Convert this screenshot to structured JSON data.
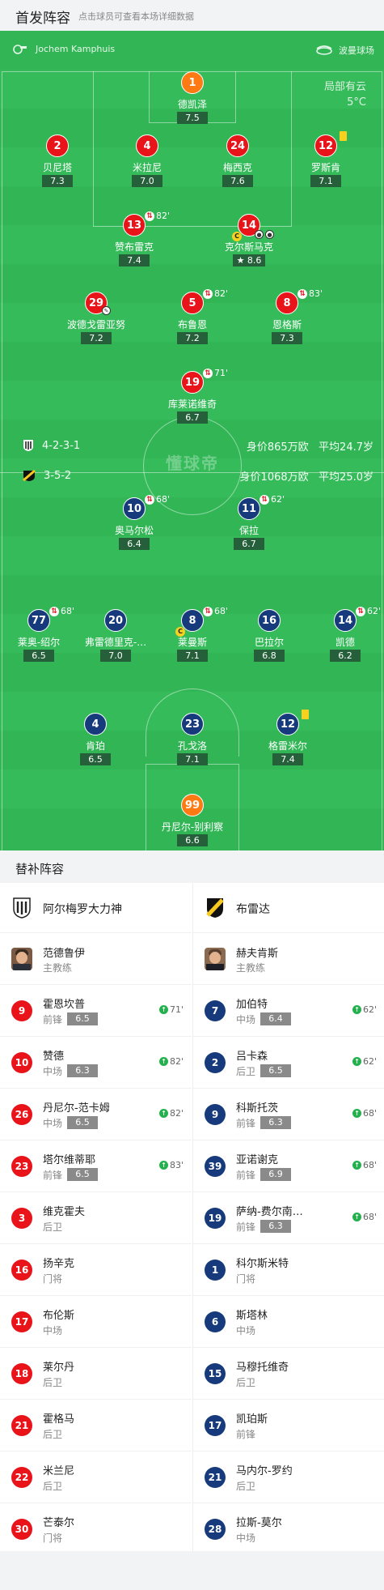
{
  "header": {
    "title": "首发阵容",
    "tip": "点击球员可查看本场详细数据"
  },
  "match": {
    "referee": "Jochem Kamphuis",
    "venue": "波曼球场",
    "weather": "局部有云",
    "temperature": "5°C"
  },
  "colors": {
    "pitch": "#31b555",
    "home": "#e8141a",
    "away": "#163a7c",
    "gk": "#ff7a12",
    "yellow_card": "#f7d11e"
  },
  "watermark": "懂球帝",
  "home_team": {
    "formation": "4-2-3-1",
    "value": "身价865万欧",
    "age": "平均24.7岁",
    "players": [
      {
        "num": "1",
        "name": "德凯泽",
        "rating": "7.5",
        "role": "gk"
      },
      {
        "num": "2",
        "name": "贝尼塔",
        "rating": "7.3"
      },
      {
        "num": "4",
        "name": "米拉尼",
        "rating": "7.0"
      },
      {
        "num": "24",
        "name": "梅西克",
        "rating": "7.6"
      },
      {
        "num": "12",
        "name": "罗斯肯",
        "rating": "7.1",
        "card": "yellow"
      },
      {
        "num": "13",
        "name": "赞布雷克",
        "rating": "7.4",
        "sub_min": "82'"
      },
      {
        "num": "14",
        "name": "克尔斯马克",
        "rating": "8.6",
        "captain": true,
        "goals": 2,
        "motm": true
      },
      {
        "num": "29",
        "name": "波德戈雷亚努",
        "rating": "7.2",
        "assist": true
      },
      {
        "num": "5",
        "name": "布鲁恩",
        "rating": "7.2",
        "sub_min": "82'"
      },
      {
        "num": "8",
        "name": "恩格斯",
        "rating": "7.3",
        "sub_min": "83'"
      },
      {
        "num": "19",
        "name": "库莱诺维奇",
        "rating": "6.7",
        "sub_min": "71'"
      }
    ]
  },
  "away_team": {
    "formation": "3-5-2",
    "value": "身价1068万欧",
    "age": "平均25.0岁",
    "players": [
      {
        "num": "10",
        "name": "奥马尔松",
        "rating": "6.4",
        "sub_min": "68'"
      },
      {
        "num": "11",
        "name": "保拉",
        "rating": "6.7",
        "sub_min": "62'"
      },
      {
        "num": "77",
        "name": "莱奥-绍尔",
        "rating": "6.5",
        "sub_min": "68'"
      },
      {
        "num": "20",
        "name": "弗雷德里克-…",
        "rating": "7.0"
      },
      {
        "num": "8",
        "name": "莱曼斯",
        "rating": "7.1",
        "sub_min": "68'",
        "captain": true
      },
      {
        "num": "16",
        "name": "巴拉尔",
        "rating": "6.8"
      },
      {
        "num": "14",
        "name": "凯德",
        "rating": "6.2",
        "sub_min": "62'"
      },
      {
        "num": "4",
        "name": "肯珀",
        "rating": "6.5"
      },
      {
        "num": "23",
        "name": "孔戈洛",
        "rating": "7.1"
      },
      {
        "num": "12",
        "name": "格雷米尔",
        "rating": "7.4",
        "card": "yellow"
      },
      {
        "num": "99",
        "name": "丹尼尔-别利察",
        "rating": "6.6",
        "role": "gk"
      }
    ]
  },
  "subs_title": "替补阵容",
  "home_subs": {
    "team": "阿尔梅罗大力神",
    "coach_name": "范德鲁伊",
    "coach_role": "主教练",
    "list": [
      {
        "num": "9",
        "name": "霍恩坎普",
        "pos": "前锋",
        "rating": "6.5",
        "min": "71'"
      },
      {
        "num": "10",
        "name": "赞德",
        "pos": "中场",
        "rating": "6.3",
        "min": "82'"
      },
      {
        "num": "26",
        "name": "丹尼尔-范卡姆",
        "pos": "中场",
        "rating": "6.5",
        "min": "82'"
      },
      {
        "num": "23",
        "name": "塔尔维蒂耶",
        "pos": "前锋",
        "rating": "6.5",
        "min": "83'"
      },
      {
        "num": "3",
        "name": "维克霍夫",
        "pos": "后卫"
      },
      {
        "num": "16",
        "name": "扬辛克",
        "pos": "门将"
      },
      {
        "num": "17",
        "name": "布伦斯",
        "pos": "中场"
      },
      {
        "num": "18",
        "name": "莱尔丹",
        "pos": "后卫"
      },
      {
        "num": "21",
        "name": "霍格马",
        "pos": "后卫"
      },
      {
        "num": "22",
        "name": "米兰尼",
        "pos": "后卫"
      },
      {
        "num": "30",
        "name": "芒泰尔",
        "pos": "门将"
      }
    ]
  },
  "away_subs": {
    "team": "布雷达",
    "coach_name": "赫夫肯斯",
    "coach_role": "主教练",
    "list": [
      {
        "num": "7",
        "name": "加伯特",
        "pos": "中场",
        "rating": "6.4",
        "min": "62'"
      },
      {
        "num": "2",
        "name": "吕卡森",
        "pos": "后卫",
        "rating": "6.5",
        "min": "62'"
      },
      {
        "num": "9",
        "name": "科斯托茨",
        "pos": "前锋",
        "rating": "6.3",
        "min": "68'"
      },
      {
        "num": "39",
        "name": "亚诺谢克",
        "pos": "前锋",
        "rating": "6.9",
        "min": "68'"
      },
      {
        "num": "19",
        "name": "萨纳-费尔南…",
        "pos": "前锋",
        "rating": "6.3",
        "min": "68'"
      },
      {
        "num": "1",
        "name": "科尔斯米特",
        "pos": "门将"
      },
      {
        "num": "6",
        "name": "斯塔林",
        "pos": "中场"
      },
      {
        "num": "15",
        "name": "马穆托维奇",
        "pos": "后卫"
      },
      {
        "num": "17",
        "name": "凯珀斯",
        "pos": "前锋"
      },
      {
        "num": "21",
        "name": "马内尔-罗约",
        "pos": "后卫"
      },
      {
        "num": "28",
        "name": "拉斯-莫尔",
        "pos": "中场"
      }
    ]
  }
}
